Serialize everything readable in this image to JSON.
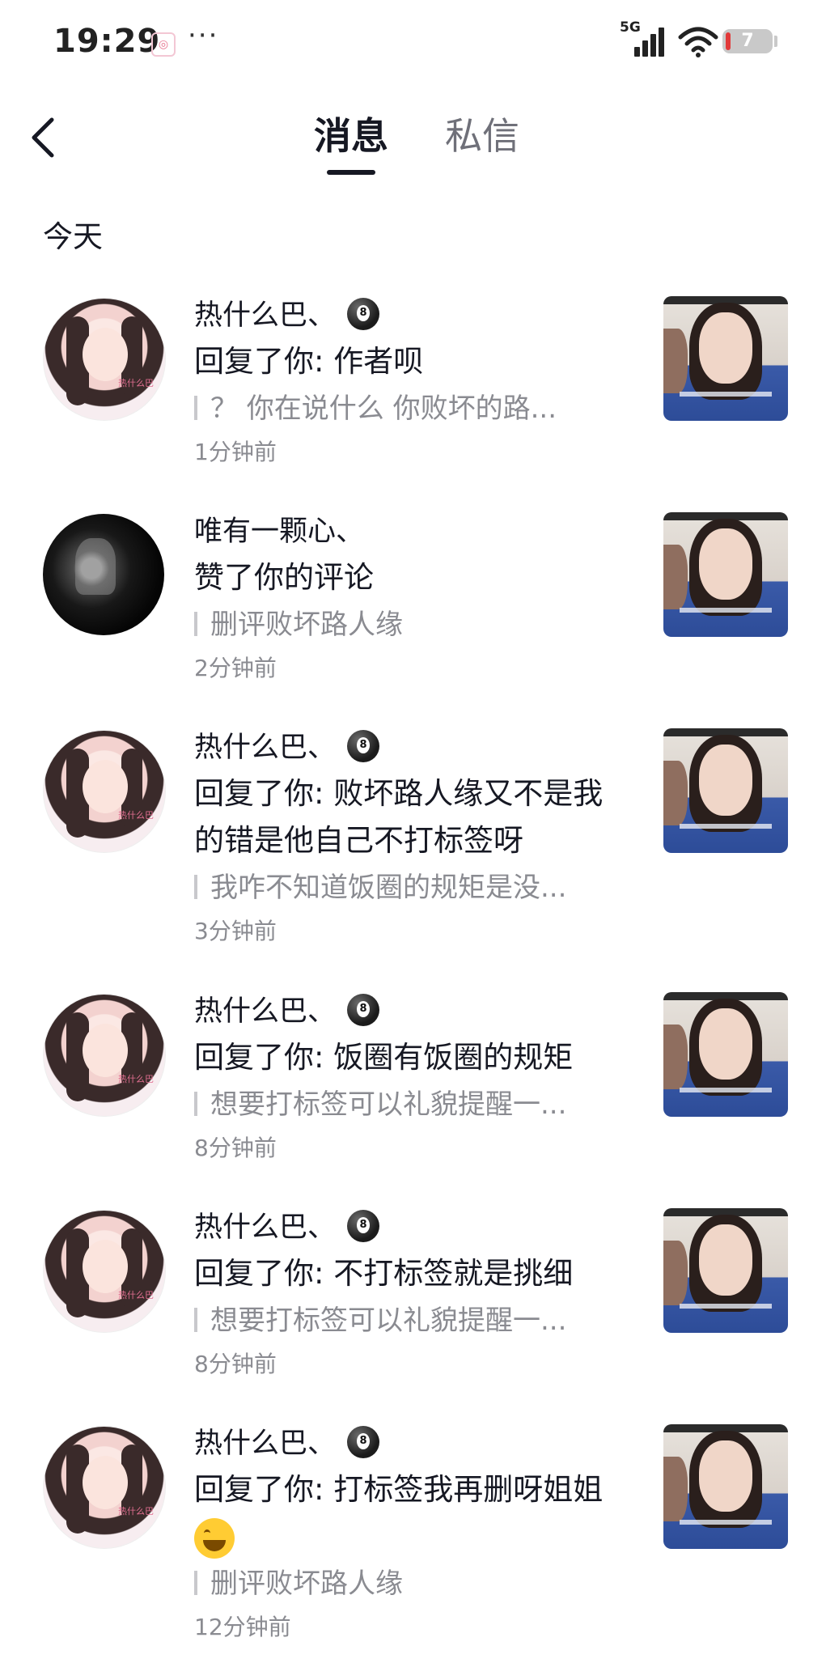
{
  "status_bar": {
    "time": "19:29",
    "more": "···",
    "network": "5G",
    "battery": "7"
  },
  "header": {
    "tab_active": "消息",
    "tab_inactive": "私信"
  },
  "section_title": "今天",
  "messages": [
    {
      "name": "热什么巴、",
      "action": "回复了你: 作者呗",
      "quote": "？ 你在说什么 你败坏的路...",
      "time": "1分钟前"
    },
    {
      "name": "唯有一颗心、",
      "action": "赞了你的评论",
      "quote": "删评败坏路人缘",
      "time": "2分钟前"
    },
    {
      "name": "热什么巴、",
      "action": "回复了你: 败坏路人缘又不是我的错是他自己不打标签呀",
      "quote": "我咋不知道饭圈的规矩是没...",
      "time": "3分钟前"
    },
    {
      "name": "热什么巴、",
      "action": "回复了你: 饭圈有饭圈的规矩",
      "quote": "想要打标签可以礼貌提醒一...",
      "time": "8分钟前"
    },
    {
      "name": "热什么巴、",
      "action": "回复了你: 不打标签就是挑细",
      "quote": "想要打标签可以礼貌提醒一...",
      "time": "8分钟前"
    },
    {
      "name": "热什么巴、",
      "action": "回复了你: 打标签我再删呀姐姐",
      "quote": "删评败坏路人缘",
      "time": "12分钟前"
    }
  ]
}
